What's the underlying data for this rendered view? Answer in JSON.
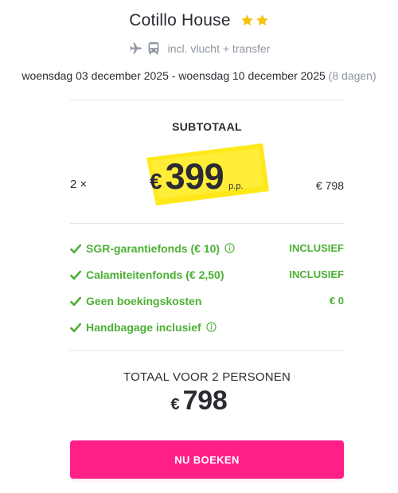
{
  "hotel": {
    "name": "Cotillo House",
    "star_count": 2,
    "star_color": "#f4c20d"
  },
  "transport": {
    "icons": [
      "plane-icon",
      "bus-icon"
    ],
    "label": "incl. vlucht + transfer"
  },
  "dates": {
    "range": "woensdag 03 december 2025 - woensdag 10 december 2025",
    "duration": "(8 dagen)"
  },
  "subtotal": {
    "title": "SUBTOTAAL",
    "quantity": "2 ×",
    "currency": "€",
    "price": "399",
    "per_person": "p.p.",
    "line_total": "€ 798",
    "highlight_color": "#ffe81a"
  },
  "features": [
    {
      "label": "SGR-garantiefonds  (€ 10)",
      "has_info": true,
      "status": "INCLUSIEF"
    },
    {
      "label": "Calamiteitenfonds  (€ 2,50)",
      "has_info": false,
      "status": "INCLUSIEF"
    },
    {
      "label": "Geen boekingskosten",
      "has_info": false,
      "status": "€ 0"
    },
    {
      "label": "Handbagage inclusief",
      "has_info": true,
      "status": ""
    }
  ],
  "total": {
    "title": "TOTAAL VOOR 2 PERSONEN",
    "currency": "€",
    "amount": "798"
  },
  "cta": {
    "label": "NU BOEKEN",
    "color": "#ff1f87"
  },
  "colors": {
    "green": "#4cb035",
    "muted": "#8e96a3",
    "text": "#2b2b33"
  }
}
